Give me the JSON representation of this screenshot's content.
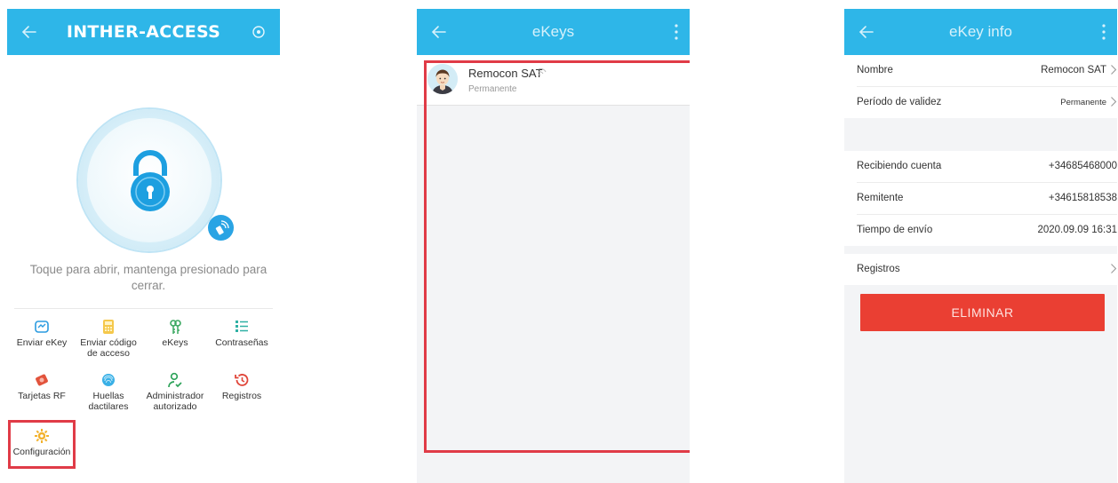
{
  "screen1": {
    "title": "INTHER-ACCESS",
    "hint": "Toque para abrir, mantenga presionado para cerrar.",
    "grid": [
      {
        "label": "Enviar eKey",
        "icon": "send-ekey-icon"
      },
      {
        "label": "Enviar código de acceso",
        "icon": "send-code-icon"
      },
      {
        "label": "eKeys",
        "icon": "ekeys-icon"
      },
      {
        "label": "Contraseñas",
        "icon": "passwords-icon"
      },
      {
        "label": "Tarjetas RF",
        "icon": "rf-card-icon"
      },
      {
        "label": "Huellas dactilares",
        "icon": "fingerprint-icon"
      },
      {
        "label": "Administrador autorizado",
        "icon": "admin-icon"
      },
      {
        "label": "Registros",
        "icon": "records-icon"
      },
      {
        "label": "Configuración",
        "icon": "settings-gear-icon"
      }
    ],
    "colors": {
      "accent": "#2eb6e8",
      "highlight": "#e03b47"
    }
  },
  "screen2": {
    "title": "eKeys",
    "ekey": {
      "name": "Remocon SAT",
      "validity": "Permanente"
    }
  },
  "screen3": {
    "title": "eKey info",
    "rows": [
      {
        "label": "Nombre",
        "value": "Remocon SAT"
      },
      {
        "label": "Período de validez",
        "value": "Permanente"
      },
      {
        "label": "Recibiendo cuenta",
        "value": "+34685468000"
      },
      {
        "label": "Remitente",
        "value": "+34615818538"
      },
      {
        "label": "Tiempo de envío",
        "value": "2020.09.09 16:31"
      },
      {
        "label": "Registros",
        "value": ""
      }
    ],
    "delete_label": "ELIMINAR",
    "colors": {
      "delete": "#ea3f33"
    }
  }
}
